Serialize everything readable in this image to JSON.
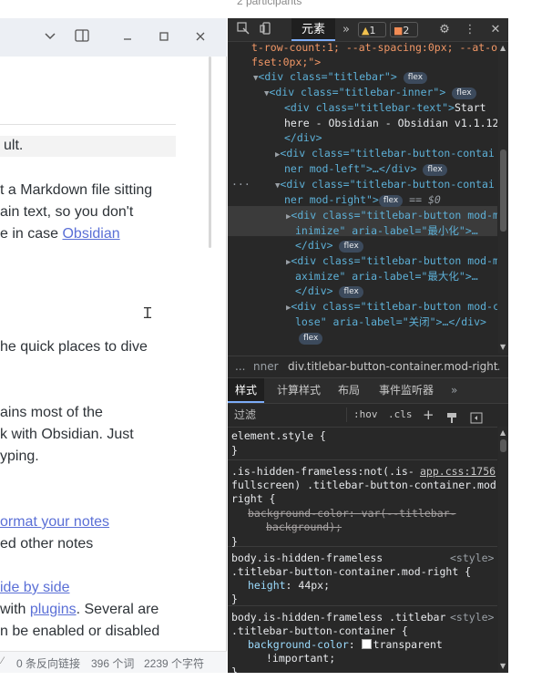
{
  "background": {
    "participants_text": "2 participants"
  },
  "obsidian": {
    "content_lines": [
      "ult.",
      "t a Markdown file sitting",
      "ain text, so you don't",
      "e in case ",
      "he quick places to dive",
      "ains most of the",
      "k with Obsidian. Just",
      "yping.",
      "ed other notes",
      "with ",
      ". Several are",
      "n be enabled or disabled"
    ],
    "links": {
      "obsidian": "Obsidian",
      "format_notes": "ormat your notes",
      "side_by_side": "ide by side",
      "plugins": "plugins"
    },
    "status": {
      "backlinks": "0 条反向链接",
      "words": "396 个词",
      "chars": "2239 个字符"
    },
    "icons": {
      "chevron": "chevron-down-icon",
      "sidebar": "sidebar-toggle-icon",
      "minimize": "minimize-icon",
      "maximize": "maximize-icon",
      "close": "close-icon"
    }
  },
  "devtools": {
    "toolbar": {
      "elements_tab": "元素",
      "warnings_count": "1",
      "issues_count": "2"
    },
    "dom_lines": {
      "l0": "t-row-count:1; --at-spacing:0px; --at-of",
      "l1": "fset:0px;\">",
      "titlebar_open": "<div class=\"titlebar\">",
      "inner_open": "<div class=\"titlebar-inner\">",
      "text_open": "<div class=\"titlebar-text\">",
      "text_content_a": "Start",
      "text_content_b": "here - Obsidian - Obsidian v1.1.12",
      "close_div": "</div>",
      "left_a": "<div class=\"titlebar-button-contai",
      "left_b": "ner mod-left\">…</div>",
      "right_a": "<div class=\"titlebar-button-contai",
      "right_b": "ner mod-right\">",
      "eq_sel": "== $0",
      "min_a": "<div class=\"titlebar-button mod-m",
      "min_b": "inimize\" aria-label=\"最小化\">…",
      "max_a": "<div class=\"titlebar-button mod-m",
      "max_b": "aximize\" aria-label=\"最大化\">…",
      "cls_a": "<div class=\"titlebar-button mod-c",
      "cls_b": "lose\" aria-label=\"关闭\">…</div>",
      "flex": "flex",
      "ellipsis_marker": "···"
    },
    "breadcrumb": {
      "dots": "...",
      "crumb1": "nner",
      "crumb2": "div.titlebar-button-container.mod-right",
      "more": "..."
    },
    "styles_tabs": [
      "样式",
      "计算样式",
      "布局",
      "事件监听器"
    ],
    "filter": {
      "placeholder": "过滤",
      "hov": ":hov",
      "cls": ".cls"
    },
    "rules": {
      "r0_sel": "element.style {",
      "close_brace": "}",
      "r1_sel_a": ".is-hidden-frameless:not(.is-",
      "r1_src": "app.css:1756",
      "r1_sel_b": "fullscreen) .titlebar-button-container.mod-",
      "r1_sel_c": "right {",
      "r1_prop": "background-color",
      "r1_val_a": "var(--titlebar-",
      "r1_val_b": "background);",
      "r2_sel_a": "body.is-hidden-frameless",
      "r2_src": "<style>",
      "r2_sel_b": ".titlebar-button-container.mod-right {",
      "r2_prop": "height",
      "r2_val": "44px;",
      "r3_sel_a": "body.is-hidden-frameless .titlebar",
      "r3_src": "<style>",
      "r3_sel_b": ".titlebar-button-container {",
      "r3_prop": "background-color",
      "r3_val_a": "transparent",
      "r3_val_b": "!important;"
    }
  }
}
